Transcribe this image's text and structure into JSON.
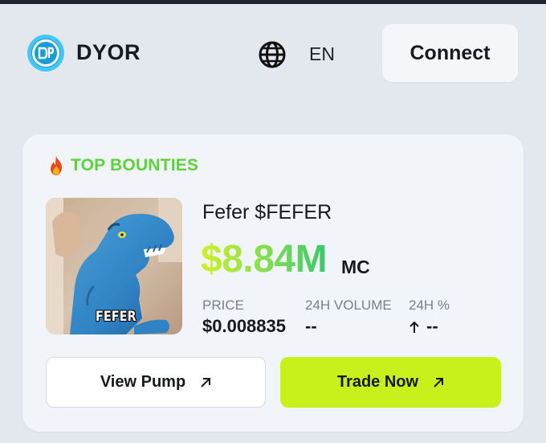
{
  "header": {
    "brand": "DYOR",
    "logo_icon": "dyor-logo-icon",
    "language_icon": "globe-icon",
    "language": "EN",
    "connect_label": "Connect"
  },
  "bounties": {
    "title": "TOP BOUNTIES",
    "title_icon": "fire-icon",
    "token": {
      "name": "Fefer $FEFER",
      "image_label": "FEFER",
      "market_cap": "$8.84M",
      "market_cap_label": "MC",
      "stats": [
        {
          "label": "PRICE",
          "value": "$0.008835"
        },
        {
          "label": "24H VOLUME",
          "value": "--"
        },
        {
          "label": "24H %",
          "value": "--",
          "icon": "arrow-up-icon"
        }
      ]
    },
    "view_pump_label": "View Pump",
    "trade_now_label": "Trade Now"
  },
  "colors": {
    "accent_green": "#5ed23c",
    "trade_button": "#c8f01b",
    "background": "#e3e8ef",
    "card": "#f1f5fa"
  }
}
